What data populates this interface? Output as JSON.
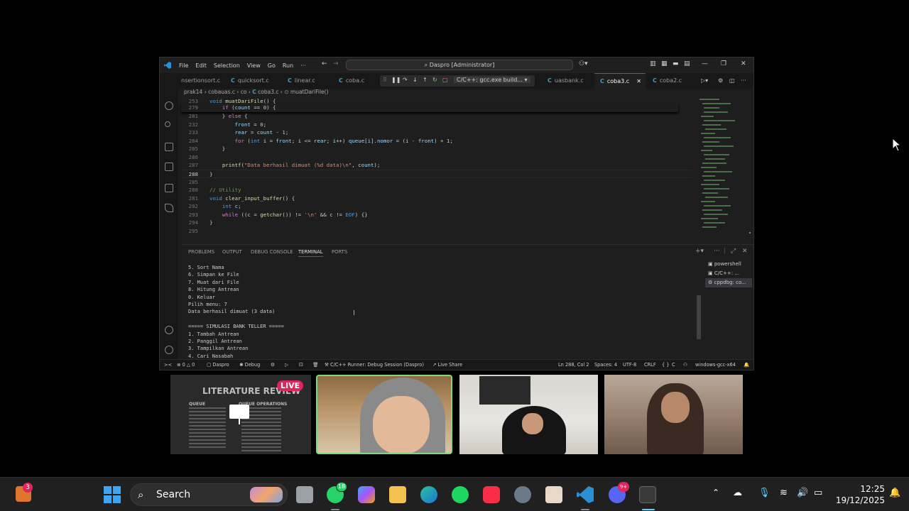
{
  "vscode": {
    "menu": [
      "File",
      "Edit",
      "Selection",
      "View",
      "Go",
      "Run",
      "···"
    ],
    "command_center": "Daspro [Administrator]",
    "tabs": [
      {
        "label": "nsertionsort.c",
        "active": false
      },
      {
        "label": "quicksort.c",
        "active": false
      },
      {
        "label": "linear.c",
        "active": false
      },
      {
        "label": "coba.c",
        "active": false
      },
      {
        "label": "uasbank.c",
        "active": false
      },
      {
        "label": "coba3.c",
        "active": true
      },
      {
        "label": "coba2.c",
        "active": false
      }
    ],
    "tab_close": "✕",
    "debug_config": "C/C++: gcc.exe build...",
    "breadcrumb": [
      "prak14",
      "cobauas.c",
      "co",
      "coba3.c",
      "muatDariFile()"
    ],
    "breadcrumb_sep": "›",
    "code_lines": [
      {
        "n": "253",
        "text": "void muatDariFile() {"
      },
      {
        "n": "279",
        "text": "    if (count == 0) {"
      },
      {
        "n": "281",
        "text": "    } else {"
      },
      {
        "n": "232",
        "text": "        front = 0;"
      },
      {
        "n": "233",
        "text": "        rear = count - 1;"
      },
      {
        "n": "284",
        "text": "        for (int i = front; i <= rear; i++) queue[i].nomor = (i - front) + 1;"
      },
      {
        "n": "285",
        "text": "    }"
      },
      {
        "n": "286",
        "text": ""
      },
      {
        "n": "287",
        "text": "    printf(\"Data berhasil dimuat (%d data)\\n\", count);"
      },
      {
        "n": "288",
        "text": "}"
      },
      {
        "n": "285",
        "text": ""
      },
      {
        "n": "280",
        "text": "// Utility"
      },
      {
        "n": "281",
        "text": "void clear_input_buffer() {"
      },
      {
        "n": "292",
        "text": "    int c;"
      },
      {
        "n": "293",
        "text": "    while ((c = getchar()) != '\\n' && c != EOF) {}"
      },
      {
        "n": "294",
        "text": "}"
      },
      {
        "n": "295",
        "text": ""
      }
    ],
    "panel_tabs": [
      "PROBLEMS",
      "OUTPUT",
      "DEBUG CONSOLE",
      "TERMINAL",
      "PORTS"
    ],
    "active_panel_tab": "TERMINAL",
    "terminal_lines": [
      "5. Sort Nama",
      "6. Simpan ke File",
      "7. Muat dari File",
      "8. Hitung Antrean",
      "0. Keluar",
      "Pilih menu: 7",
      "Data berhasil dimuat (3 data)",
      "",
      "===== SIMULASI BANK TELLER =====",
      "1. Tambah Antrean",
      "2. Panggil Antrean",
      "3. Tampilkan Antrean",
      "4. Cari Nasabah"
    ],
    "terminal_instances": [
      "powershell",
      "C/C++: ...",
      "cppdbg: co..."
    ],
    "status": {
      "errors": "0",
      "warnings": "0",
      "workspace": "Daspro",
      "debug": "Debug",
      "runner": "C/C++ Runner: Debug Session (Daspro)",
      "live_share": "Live Share",
      "position": "Ln 288, Col 2",
      "spaces": "Spaces: 4",
      "encoding": "UTF-8",
      "eol": "CRLF",
      "lang_braces": "{ }",
      "language": "C",
      "platform": "windows-gcc-x64"
    }
  },
  "meeting": {
    "shared_title": "LITERATURE REVIEW",
    "live_badge": "LIVE",
    "col_left": "QUEUE",
    "col_right": "QUEUE OPERATIONS"
  },
  "taskbar": {
    "search_placeholder": "Search",
    "widget_badge": "3",
    "whatsapp_badge": "18",
    "discord_badge": "9+",
    "time": "12:25",
    "date": "19/12/2025"
  }
}
